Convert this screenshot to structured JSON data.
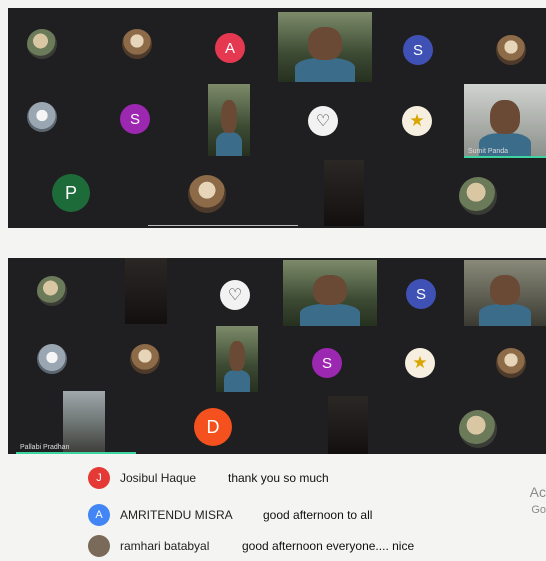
{
  "panel_top": {
    "avatars": [
      {
        "letter": "A",
        "color": "#e53952"
      },
      {
        "letter": "S",
        "color": "#3f51b5"
      },
      {
        "letter": "S",
        "color": "#9c27b0"
      },
      {
        "letter": "P",
        "color": "#1e6b3a"
      }
    ],
    "name_tag": "Sumit Panda"
  },
  "panel_bottom": {
    "avatars": [
      {
        "letter": "S",
        "color": "#3f51b5"
      },
      {
        "letter": "S",
        "color": "#9c27b0"
      },
      {
        "letter": "D",
        "color": "#f4511e"
      }
    ],
    "name_tag": "Pallabi Pradhan"
  },
  "chat": [
    {
      "avatar_letter": "J",
      "avatar_color": "#e53935",
      "name": "Josibul Haque",
      "message": "thank you so much"
    },
    {
      "avatar_letter": "A",
      "avatar_color": "#4285f4",
      "name": "AMRITENDU MISRA",
      "message": "good afternoon to all"
    },
    {
      "avatar_letter": "",
      "avatar_color": "#7a6a5a",
      "name": "ramhari batabyal",
      "message": "good afternoon everyone.... nice"
    }
  ],
  "side_text": {
    "line1": "Ac",
    "line2": "Go"
  }
}
